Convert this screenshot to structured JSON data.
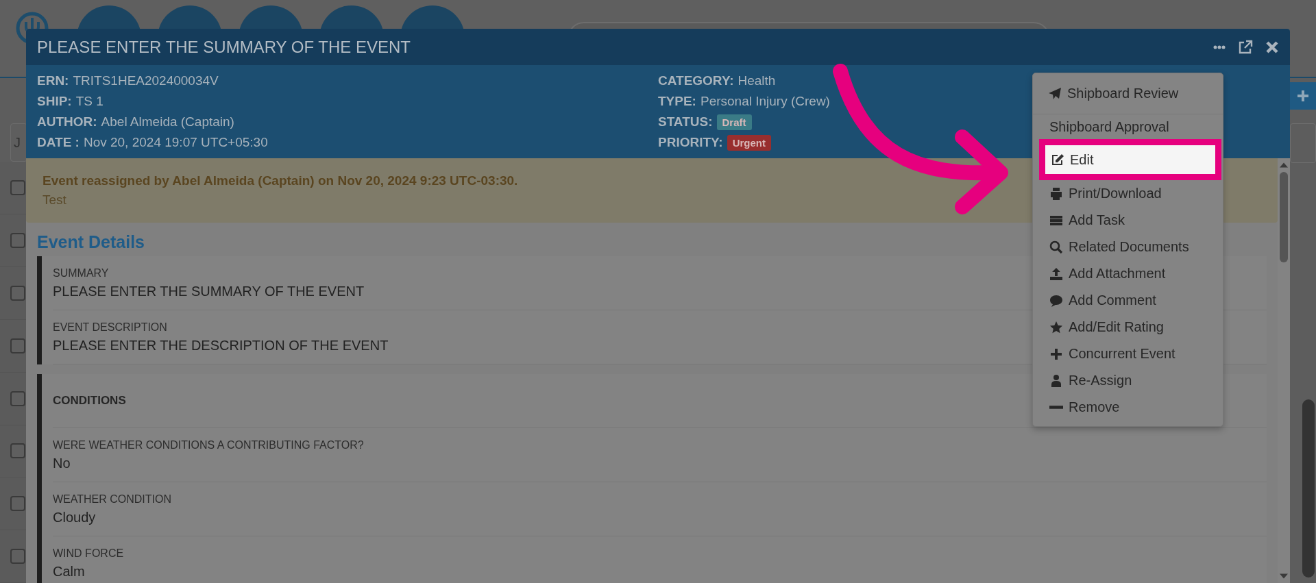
{
  "app": {
    "filter": {
      "value": "J"
    },
    "list_rows": [
      {
        "checked": false
      },
      {
        "checked": false
      },
      {
        "checked": false
      },
      {
        "checked": false
      },
      {
        "checked": false
      },
      {
        "checked": false
      },
      {
        "checked": false
      },
      {
        "checked": false
      }
    ]
  },
  "modal": {
    "title": "PLEASE ENTER THE SUMMARY OF THE EVENT",
    "info_left": [
      {
        "label": "ERN:",
        "kind": "text",
        "value": "TRITS1HEA202400034V"
      },
      {
        "label": "SHIP:",
        "kind": "text",
        "value": "TS 1"
      },
      {
        "label": "AUTHOR:",
        "kind": "text",
        "value": "Abel Almeida (Captain)"
      },
      {
        "label": "DATE :",
        "kind": "text",
        "value": "Nov 20, 2024 19:07 UTC+05:30"
      }
    ],
    "info_right": [
      {
        "label": "CATEGORY:",
        "kind": "text",
        "value": "Health"
      },
      {
        "label": "TYPE:",
        "kind": "text",
        "value": "Personal Injury (Crew)"
      },
      {
        "label": "STATUS:",
        "kind": "badge",
        "value": "Draft",
        "color": "#3a7b86"
      },
      {
        "label": "PRIORITY:",
        "kind": "badge",
        "value": "Urgent",
        "color": "#982e2e"
      }
    ],
    "alert": {
      "title": "Event reassigned by Abel Almeida (Captain) on Nov 20, 2024 9:23 UTC-03:30.",
      "text": "Test"
    },
    "details": {
      "heading": "Event Details",
      "sections": [
        {
          "fields": [
            {
              "label": "SUMMARY",
              "value": "PLEASE ENTER THE SUMMARY OF THE EVENT"
            },
            {
              "label": "EVENT DESCRIPTION",
              "value": "PLEASE ENTER THE DESCRIPTION OF THE EVENT"
            }
          ]
        },
        {
          "title": "CONDITIONS",
          "fields": [
            {
              "label": "WERE WEATHER CONDITIONS A CONTRIBUTING FACTOR?",
              "value": "No"
            },
            {
              "label": "WEATHER CONDITION",
              "value": "Cloudy"
            },
            {
              "label": "WIND FORCE",
              "value": "Calm"
            }
          ]
        }
      ]
    },
    "menu": [
      {
        "label": "Shipboard Review",
        "selected": false
      },
      {
        "label": "Shipboard Approval",
        "selected": false
      },
      {
        "label": "Edit",
        "selected": true
      },
      {
        "label": "Print/Download",
        "selected": false
      },
      {
        "label": "Add Task",
        "selected": false
      },
      {
        "label": "Related Documents",
        "selected": false
      },
      {
        "label": "Add Attachment",
        "selected": false
      },
      {
        "label": "Add Comment",
        "selected": false
      },
      {
        "label": "Add/Edit Rating",
        "selected": false
      },
      {
        "label": "Concurrent Event",
        "selected": false
      },
      {
        "label": "Re-Assign",
        "selected": false
      },
      {
        "label": "Remove",
        "selected": false
      }
    ]
  }
}
